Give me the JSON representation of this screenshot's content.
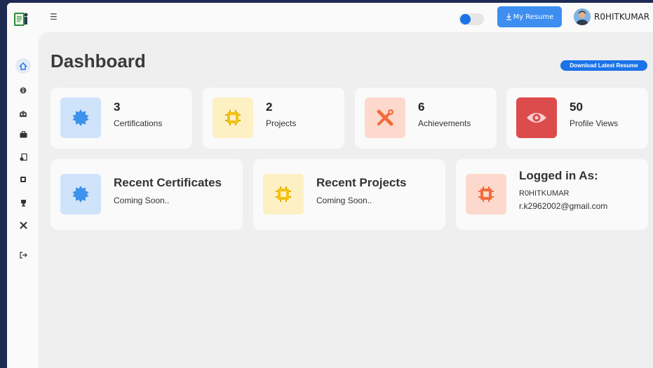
{
  "header": {
    "menu_icon": "hamburger-icon",
    "resume_button": "My Resume",
    "resume_icon": "download-icon",
    "username": "R0HITKUMAR",
    "theme_toggle": {
      "on": true
    }
  },
  "sidebar": {
    "items": [
      {
        "icon": "home-icon",
        "active": true
      },
      {
        "icon": "info-icon"
      },
      {
        "icon": "education-icon"
      },
      {
        "icon": "briefcase-icon"
      },
      {
        "icon": "certificate-icon"
      },
      {
        "icon": "chip-icon"
      },
      {
        "icon": "trophy-icon"
      },
      {
        "icon": "tools-icon"
      },
      {
        "icon": "logout-icon"
      }
    ]
  },
  "main": {
    "title": "Dashboard",
    "download_button": "Download Latest Resume",
    "stats": [
      {
        "value": "3",
        "label": "Certifications",
        "icon": "badge-icon",
        "color": "#cfe3fb"
      },
      {
        "value": "2",
        "label": "Projects",
        "icon": "chip-icon",
        "color": "#fdf0c3"
      },
      {
        "value": "6",
        "label": "Achievements",
        "icon": "tools-icon",
        "color": "#fcd9cc"
      },
      {
        "value": "50",
        "label": "Profile Views",
        "icon": "eye-icon",
        "color": "#dc4c4c"
      }
    ],
    "recent_certificates": {
      "title": "Recent Certificates",
      "subtitle": "Coming Soon.."
    },
    "recent_projects": {
      "title": "Recent Projects",
      "subtitle": "Coming Soon.."
    },
    "logged_in": {
      "title": "Logged in As:",
      "name": "R0HITKUMAR",
      "email": "r.k2962002@gmail.com"
    }
  },
  "colors": {
    "accent": "#1a73e8",
    "button": "#3d8ef0",
    "background": "#efefef",
    "card": "#fafafa",
    "outer": "#1d2a52"
  }
}
